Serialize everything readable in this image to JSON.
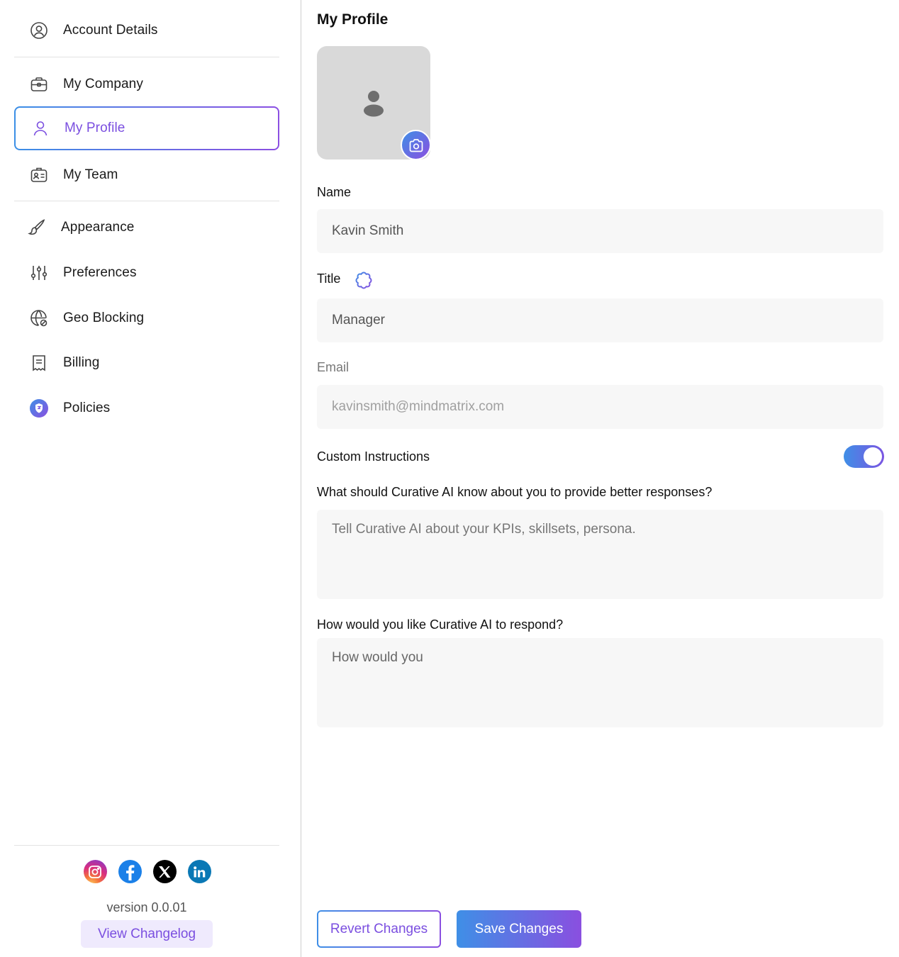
{
  "sidebar": {
    "items": [
      {
        "label": "Account Details",
        "icon": "user-circle-icon"
      },
      {
        "label": "My Company",
        "icon": "briefcase-icon"
      },
      {
        "label": "My Profile",
        "icon": "user-icon",
        "active": true
      },
      {
        "label": "My Team",
        "icon": "id-card-icon"
      },
      {
        "label": "Appearance",
        "icon": "brush-icon"
      },
      {
        "label": "Preferences",
        "icon": "sliders-icon"
      },
      {
        "label": "Geo Blocking",
        "icon": "globe-block-icon"
      },
      {
        "label": "Billing",
        "icon": "receipt-icon"
      },
      {
        "label": "Policies",
        "icon": "shield-icon"
      }
    ],
    "social": [
      "instagram-icon",
      "facebook-icon",
      "x-icon",
      "linkedin-icon"
    ],
    "version": "version 0.0.01",
    "changelog_label": "View Changelog"
  },
  "main": {
    "title": "My Profile",
    "name_label": "Name",
    "name_value": "Kavin Smith",
    "title_label": "Title",
    "title_value": "Manager",
    "email_label": "Email",
    "email_value": "kavinsmith@mindmatrix.com",
    "custom_label": "Custom Instructions",
    "custom_enabled": true,
    "q1_label": "What should Curative AI know about you to provide better responses?",
    "q1_placeholder": "Tell Curative AI about your KPIs, skillsets, persona.",
    "q2_label": "How would you like Curative AI to respond?",
    "q2_value": "How would you",
    "revert_label": "Revert Changes",
    "save_label": "Save Changes"
  },
  "colors": {
    "accent_start": "#3f8fe6",
    "accent_end": "#8a4fe0",
    "active_text": "#7b4fe0"
  }
}
